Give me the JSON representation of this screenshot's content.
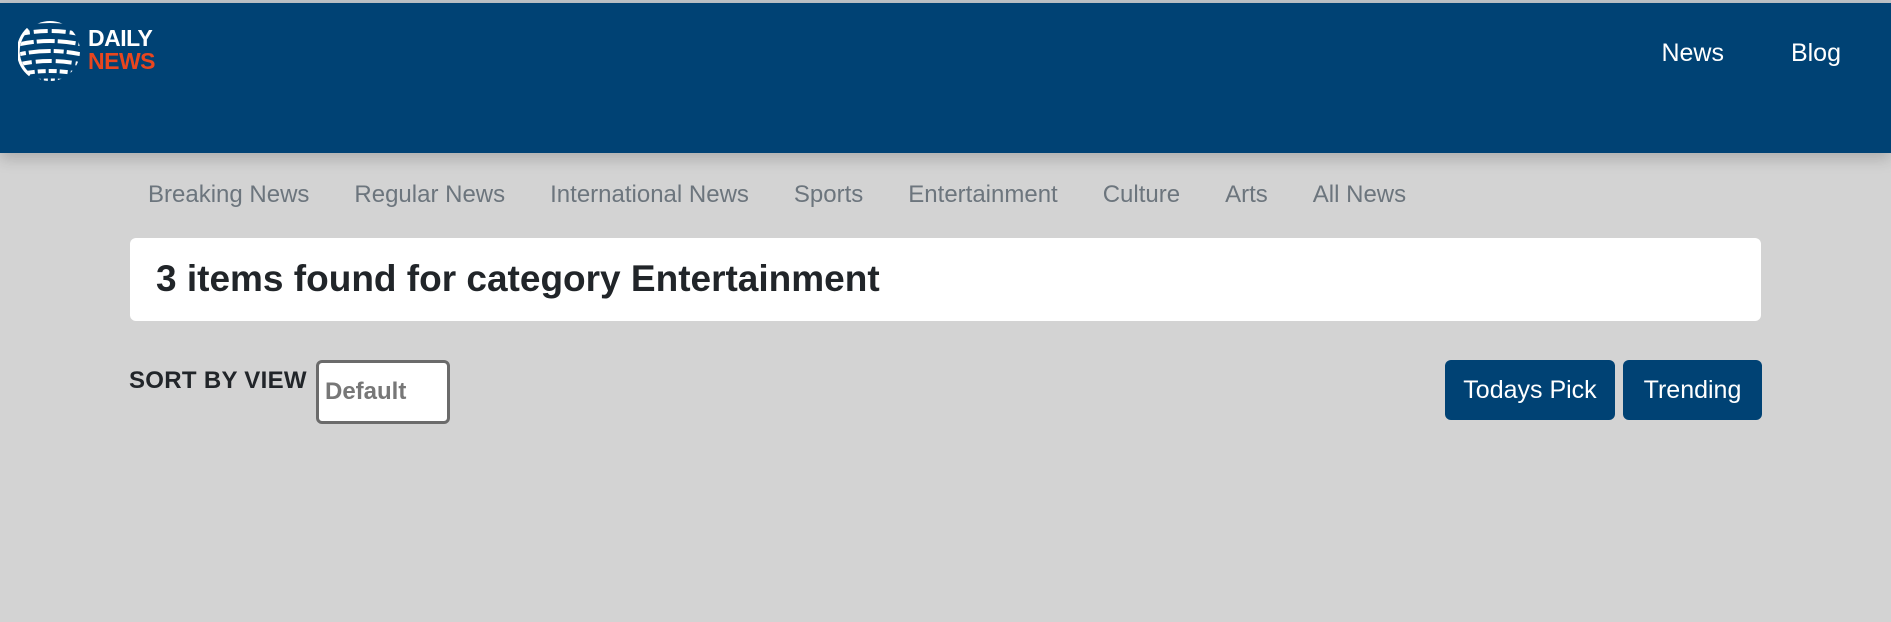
{
  "brand": {
    "name_line1": "DAILY",
    "name_line2": "NEWS",
    "colors": {
      "header_bg": "#004274",
      "accent": "#e8461f",
      "page_bg": "#d3d3d3"
    },
    "logo_icon": "globe-icon"
  },
  "topnav": {
    "items": [
      "News",
      "Blog"
    ]
  },
  "categories": {
    "items": [
      "Breaking News",
      "Regular News",
      "International News",
      "Sports",
      "Entertainment",
      "Culture",
      "Arts",
      "All News"
    ]
  },
  "results": {
    "heading": "3 items found for category Entertainment"
  },
  "sort": {
    "label": "SORT BY VIEW",
    "selected": "Default"
  },
  "actions": {
    "todays_pick": "Todays Pick",
    "trending": "Trending"
  }
}
